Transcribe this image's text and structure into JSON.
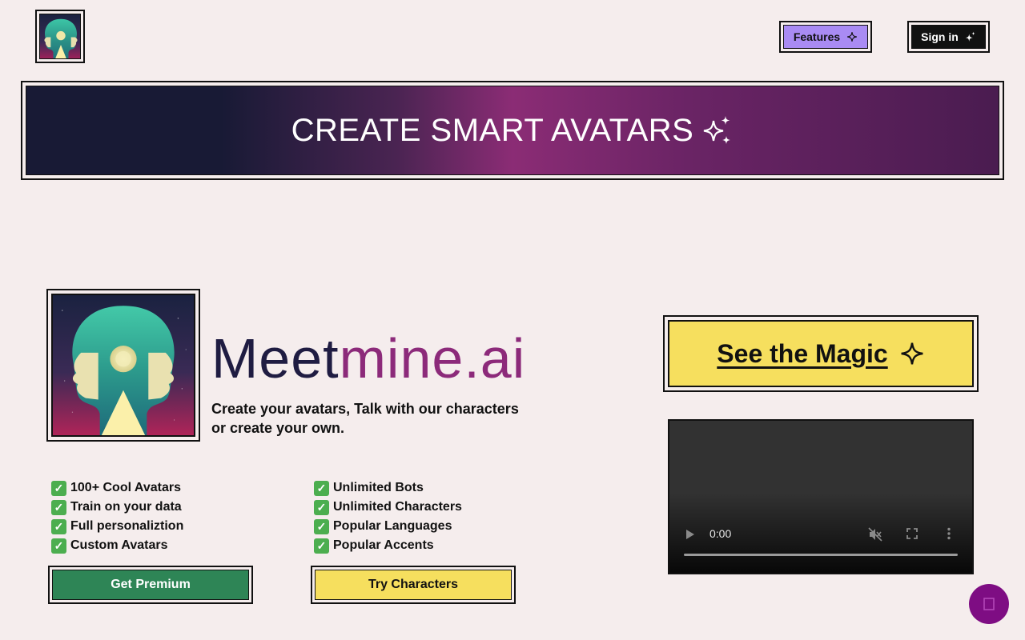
{
  "header": {
    "logo_alt": "Meetmine.ai logo",
    "features_label": "Features",
    "signin_label": "Sign in"
  },
  "banner": {
    "title": "CREATE SMART AVATARS"
  },
  "hero": {
    "brand_part1": "Meet",
    "brand_part2": "mine.ai",
    "tagline": "Create your avatars, Talk with our characters or create your own."
  },
  "features_left": [
    "100+ Cool Avatars",
    "Train on your data",
    "Full personaliztion",
    "Custom Avatars"
  ],
  "features_right": [
    "Unlimited Bots",
    "Unlimited Characters",
    "Popular Languages",
    "Popular Accents"
  ],
  "buttons": {
    "premium_label": "Get Premium",
    "characters_label": "Try Characters",
    "magic_label": "See the Magic"
  },
  "video": {
    "time": "0:00"
  },
  "colors": {
    "background": "#f5eded",
    "features_button": "#a98bf3",
    "premium_button": "#2e8556",
    "yellow_button": "#f6df5e",
    "brand_dark": "#1f1c42",
    "brand_accent": "#8c2a7a",
    "chat_bubble": "#7e0d83"
  }
}
